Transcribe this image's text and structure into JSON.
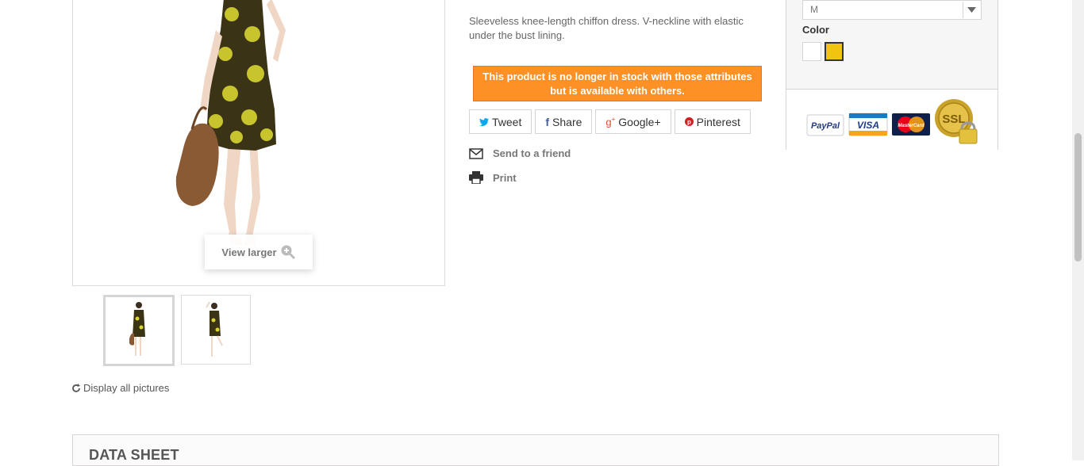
{
  "product": {
    "description": "Sleeveless knee-length chiffon dress. V-neckline with elastic under the bust lining.",
    "stock_message": "This product is no longer in stock with those attributes but is available with others."
  },
  "image_viewer": {
    "view_larger": "View larger",
    "display_all": "Display all pictures"
  },
  "social": {
    "tweet": "Tweet",
    "share": "Share",
    "googleplus": "Google+",
    "pinterest": "Pinterest",
    "colors": {
      "twitter": "#00aaf0",
      "facebook": "#435f9f",
      "google": "#e04b34",
      "pinterest": "#ce1f21"
    }
  },
  "actions": {
    "send_friend": "Send to a friend",
    "print": "Print"
  },
  "attributes": {
    "size_value": "M",
    "color_label": "Color",
    "colors": [
      "#ffffff",
      "#f1c40f"
    ]
  },
  "payment": {
    "paypal": "PayPal",
    "visa": "VISA",
    "mastercard": "MasterCard",
    "ssl": "SSL"
  },
  "datasheet": {
    "title": "DATA SHEET"
  },
  "theme": {
    "accent_orange": "#fe9126"
  }
}
